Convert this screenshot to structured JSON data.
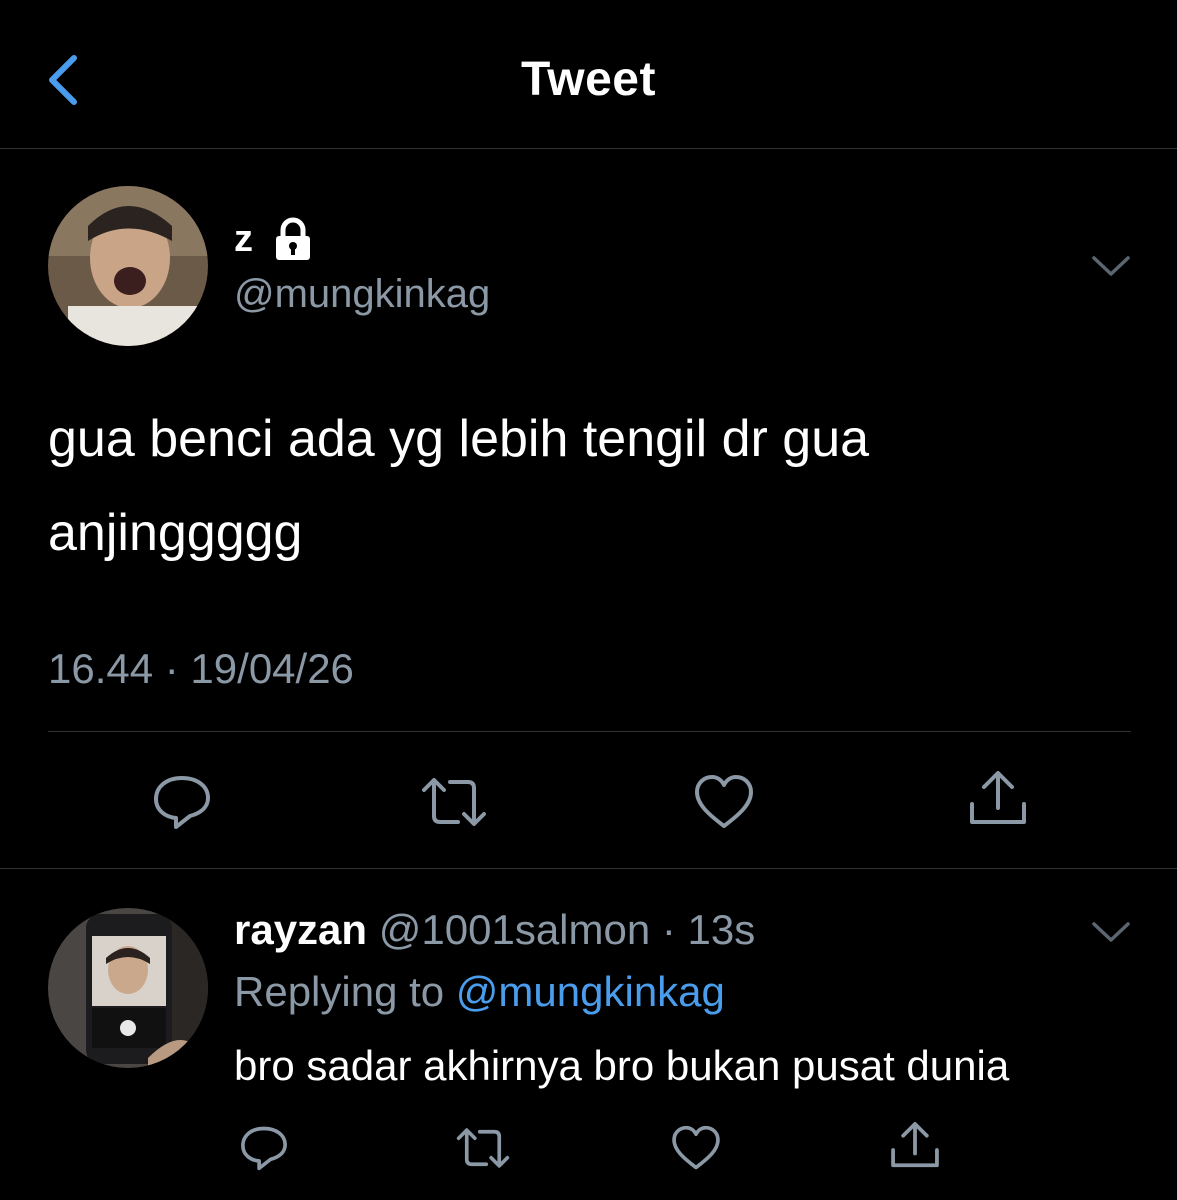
{
  "header": {
    "title": "Tweet",
    "back_icon": "chevron-left-icon"
  },
  "tweet": {
    "display_name": "z",
    "protected_icon": "lock-icon",
    "handle": "@mungkinkag",
    "text_line1": "gua benci ada yg lebih tengil dr gua",
    "text_line2": "anjinggggg",
    "timestamp": "16.44 · 19/04/26",
    "menu_icon": "chevron-down-icon",
    "actions": [
      "reply-icon",
      "retweet-icon",
      "like-icon",
      "share-icon"
    ]
  },
  "reply": {
    "display_name": "rayzan",
    "handle": "@1001salmon",
    "time": "· 13s",
    "replying_prefix": "Replying to",
    "replying_to": "@mungkinkag",
    "text": "bro sadar akhirnya bro bukan pusat dunia",
    "menu_icon": "chevron-down-icon",
    "actions": [
      "reply-icon",
      "retweet-icon",
      "like-icon",
      "share-icon"
    ]
  },
  "colors": {
    "background": "#000000",
    "secondary_text": "#8b98a5",
    "link": "#4a9ded",
    "divider": "#2f3336",
    "back_accent": "#4a9ded"
  }
}
